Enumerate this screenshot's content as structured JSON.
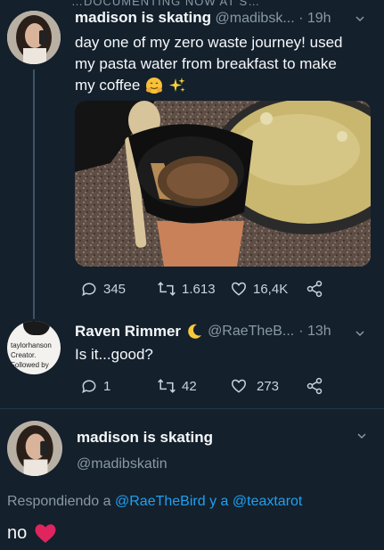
{
  "top_clip": "…DOCUMENTING NOW AT S…",
  "tweet1": {
    "name": "madison is skating",
    "handle": "@madibsk...",
    "time": "· 19h",
    "text_line1": "day one of my zero waste journey! used",
    "text_line2": "my pasta water from breakfast to make",
    "text_line3": "my coffee",
    "replies": "345",
    "retweets": "1.613",
    "likes": "16,4K"
  },
  "tweet2": {
    "name": "Raven Rimmer",
    "handle": "@RaeTheB...",
    "time": "· 13h",
    "text": "Is it...good?",
    "avatar_text_1": "taylorhanson",
    "avatar_text_2": "Creator.",
    "avatar_text_3": "Followed by",
    "replies": "1",
    "retweets": "42",
    "likes": "273"
  },
  "tweet3": {
    "name": "madison is skating",
    "handle": "@madibskatin",
    "replying_prefix": "Respondiendo a",
    "replying_user1": "@RaeTheBird",
    "replying_and": "y a",
    "replying_user2": "@teaxtarot",
    "text": "no"
  },
  "colors": {
    "background": "#14202c",
    "link": "#1da1f2",
    "muted": "#8899a6",
    "heart": "#e0245e"
  }
}
